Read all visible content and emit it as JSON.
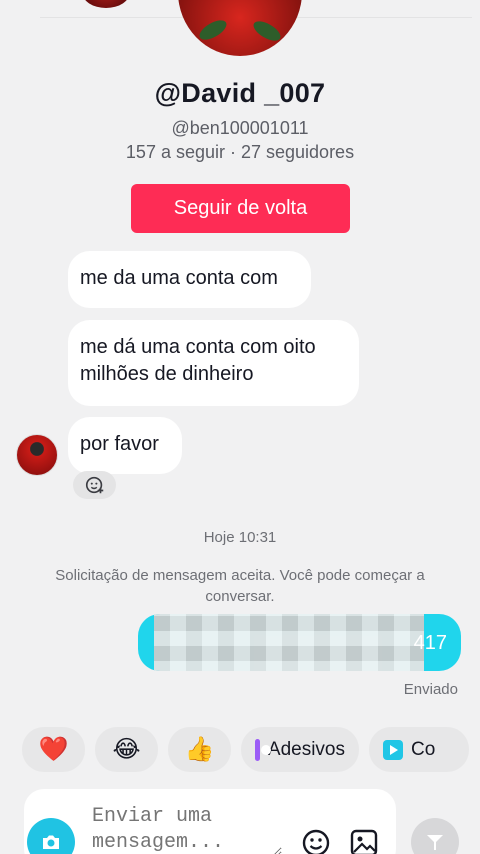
{
  "profile": {
    "display_name": "@David _007",
    "username": "@ben100001011",
    "stats": "157 a seguir · 27 seguidores",
    "follow_back_label": "Seguir de volta"
  },
  "messages": {
    "incoming": [
      "me da uma conta com",
      "me dá uma conta com oito milhões de dinheiro",
      "por favor"
    ],
    "date_separator": "Hoje 10:31",
    "system_notice": "Solicitação de mensagem aceita. Você pode começar a conversar.",
    "outgoing_visible_tail": "417",
    "outgoing_status": "Enviado"
  },
  "quick_replies": {
    "heart": "❤️",
    "laugh": "😂",
    "thumbs_up": "👍",
    "stickers_label": "Adesivos",
    "more_label": "Co"
  },
  "composer": {
    "placeholder": "Enviar uma mensagem..."
  },
  "colors": {
    "accent": "#fe2c55",
    "outgoing_bubble": "#20d5ec",
    "camera_button": "#20c3e3"
  }
}
